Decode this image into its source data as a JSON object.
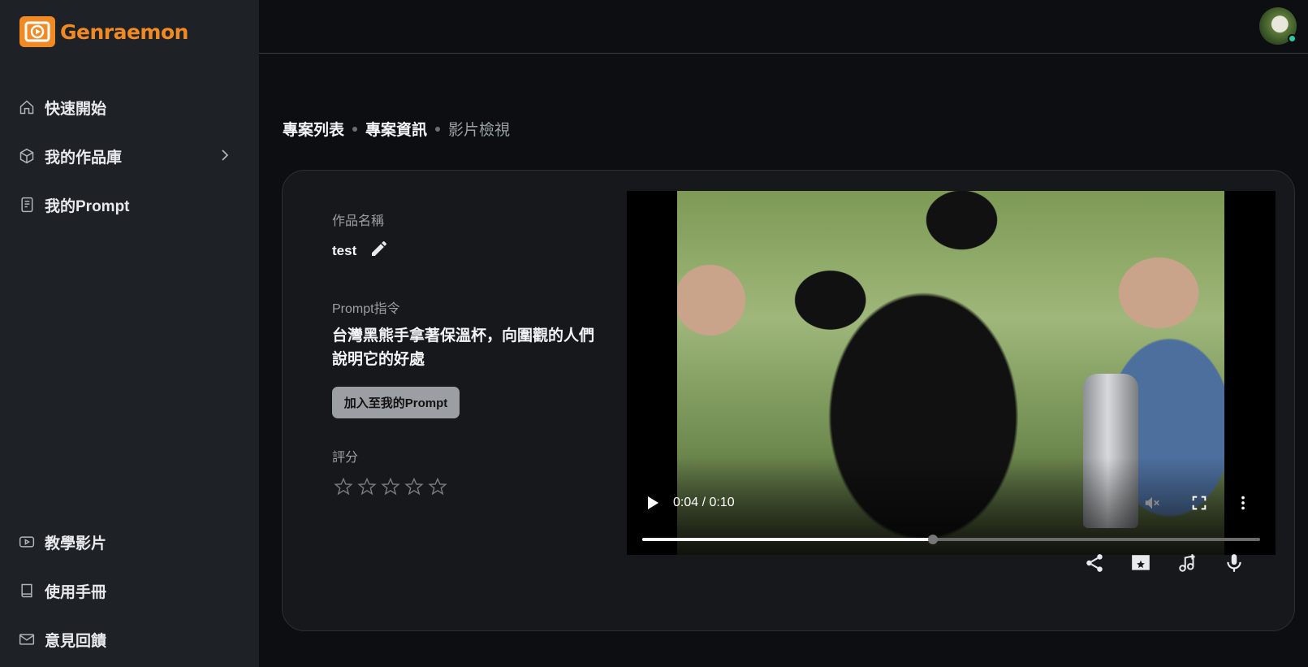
{
  "app": {
    "name": "Genraemon",
    "brand_color": "#f08a24"
  },
  "sidebar": {
    "items": [
      {
        "label": "快速開始",
        "icon": "home-icon"
      },
      {
        "label": "我的作品庫",
        "icon": "cube-icon",
        "expandable": true
      },
      {
        "label": "我的Prompt",
        "icon": "notebook-icon"
      }
    ],
    "bottom_items": [
      {
        "label": "教學影片",
        "icon": "youtube-icon"
      },
      {
        "label": "使用手冊",
        "icon": "book-icon"
      },
      {
        "label": "意見回饋",
        "icon": "mail-icon"
      }
    ]
  },
  "breadcrumb": {
    "items": [
      "專案列表",
      "專案資訊"
    ],
    "current": "影片檢視"
  },
  "detail": {
    "title_label": "作品名稱",
    "title_value": "test",
    "prompt_label": "Prompt指令",
    "prompt_text": "台灣黑熊手拿著保溫杯，向圍觀的人們說明它的好處",
    "add_button": "加入至我的Prompt",
    "rating_label": "評分",
    "rating_value": 0,
    "rating_max": 5
  },
  "video": {
    "time_display": "0:04 / 0:10",
    "progress_fraction": 0.47
  },
  "actions": [
    "share-icon",
    "movie-edit-icon",
    "music-add-icon",
    "mic-icon"
  ]
}
